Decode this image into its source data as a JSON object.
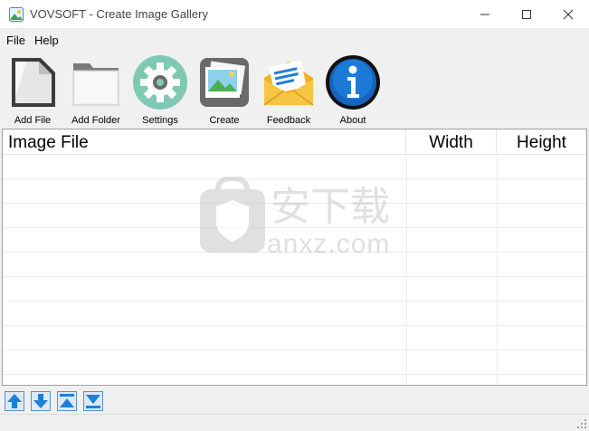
{
  "window": {
    "title": "VOVSOFT - Create Image Gallery"
  },
  "menu": {
    "items": [
      "File",
      "Help"
    ]
  },
  "toolbar": {
    "buttons": [
      {
        "label": "Add File",
        "icon": "document-icon"
      },
      {
        "label": "Add Folder",
        "icon": "folder-icon"
      },
      {
        "label": "Settings",
        "icon": "gear-icon"
      },
      {
        "label": "Create",
        "icon": "photos-icon"
      },
      {
        "label": "Feedback",
        "icon": "envelope-icon"
      },
      {
        "label": "About",
        "icon": "info-icon"
      }
    ]
  },
  "list": {
    "columns": [
      "Image File",
      "Width",
      "Height"
    ],
    "rows": []
  },
  "watermark": {
    "text": "anxz.com",
    "chinese": "安下载"
  },
  "bottom_nav": {
    "buttons": [
      "move-up-icon",
      "move-down-icon",
      "move-top-icon",
      "move-bottom-icon"
    ]
  },
  "colors": {
    "accent_blue": "#1e7fd6",
    "gear_teal": "#7fc9b4",
    "info_blue": "#1565c0"
  }
}
